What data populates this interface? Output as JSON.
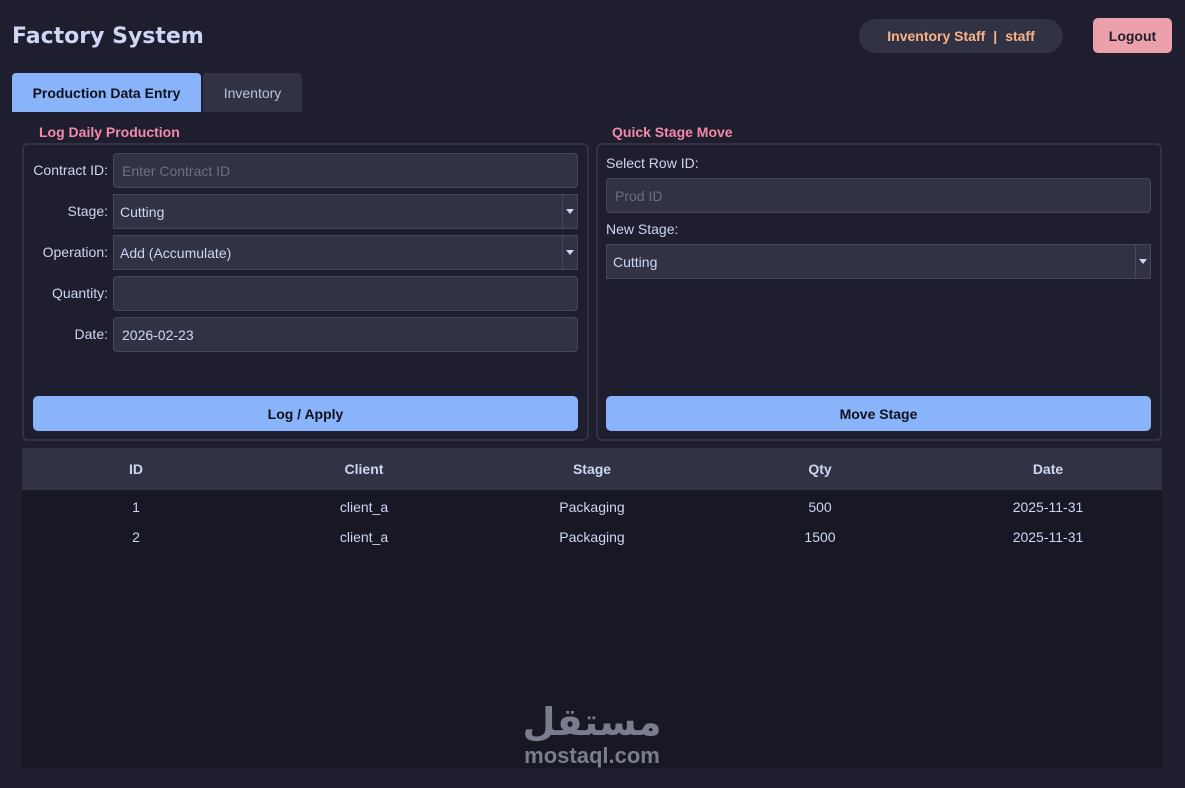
{
  "header": {
    "app_title": "Factory System",
    "user_role": "Inventory Staff",
    "user_separator": "|",
    "username": "staff",
    "logout_label": "Logout"
  },
  "tabs": [
    {
      "label": "Production Data Entry",
      "active": true
    },
    {
      "label": "Inventory",
      "active": false
    }
  ],
  "log_panel": {
    "title": "Log Daily Production",
    "contract_label": "Contract ID:",
    "contract_placeholder": "Enter Contract ID",
    "contract_value": "",
    "stage_label": "Stage:",
    "stage_value": "Cutting",
    "operation_label": "Operation:",
    "operation_value": "Add (Accumulate)",
    "quantity_label": "Quantity:",
    "quantity_value": "",
    "date_label": "Date:",
    "date_value": "2026-02-23",
    "submit_label": "Log / Apply"
  },
  "stage_panel": {
    "title": "Quick Stage Move",
    "row_label": "Select Row ID:",
    "row_placeholder": "Prod ID",
    "new_stage_label": "New Stage:",
    "new_stage_value": "Cutting",
    "submit_label": "Move Stage"
  },
  "table": {
    "columns": [
      "ID",
      "Client",
      "Stage",
      "Qty",
      "Date"
    ],
    "rows": [
      [
        "1",
        "client_a",
        "Packaging",
        "500",
        "2025-11-31"
      ],
      [
        "2",
        "client_a",
        "Packaging",
        "1500",
        "2025-11-31"
      ]
    ]
  },
  "watermark": {
    "arabic": "مستقل",
    "latin": "mostaql.com"
  },
  "colors": {
    "background": "#1e1e2e",
    "accent": "#89b4fa",
    "danger": "#eba0ac",
    "section_title": "#f38ba8",
    "user_text": "#fab387"
  }
}
